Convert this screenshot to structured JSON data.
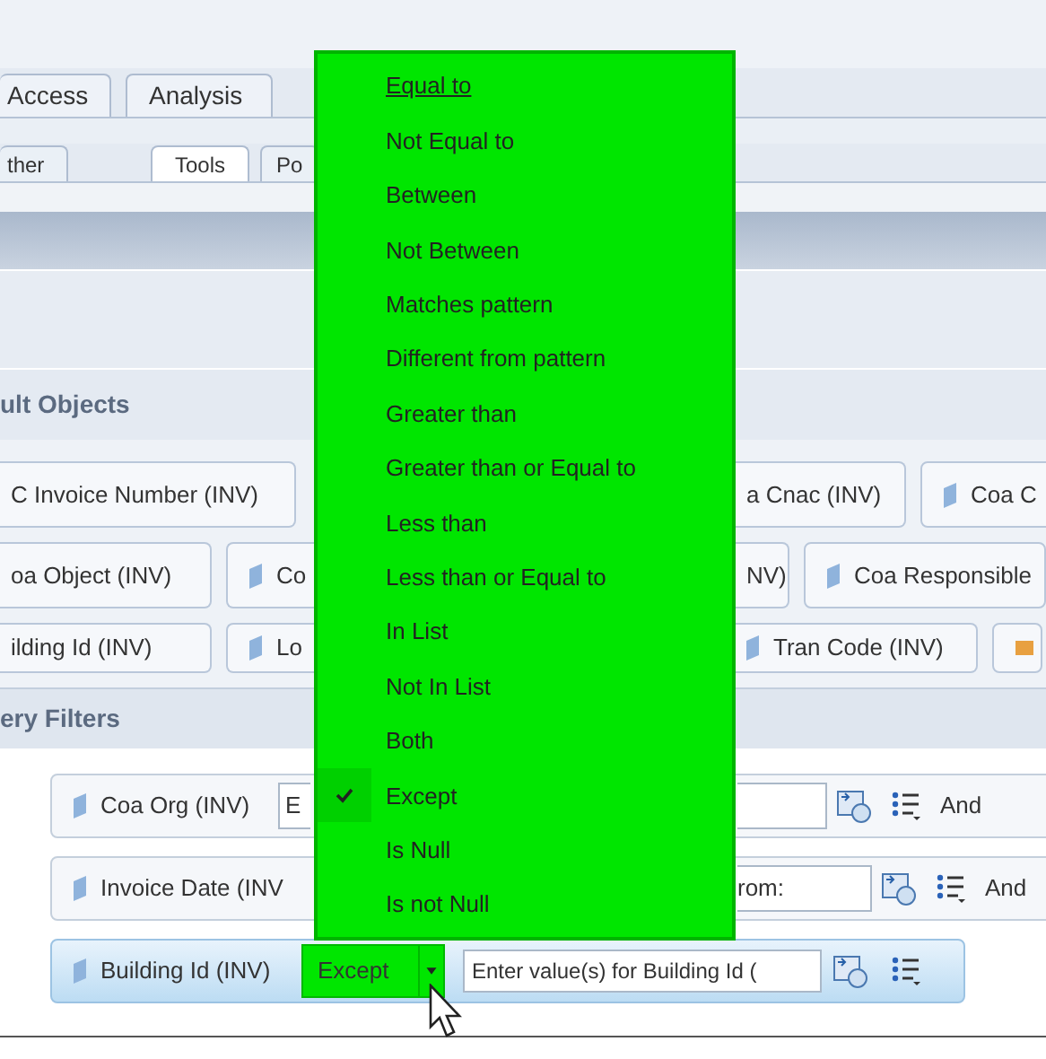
{
  "tabs": [
    {
      "label": "Access",
      "selected": false
    },
    {
      "label": "Analysis",
      "selected": false
    }
  ],
  "subtabs": [
    {
      "label": "ther",
      "selected": false
    },
    {
      "label": "Tools",
      "selected": true
    },
    {
      "label": "Po",
      "selected": false
    }
  ],
  "result_objects": {
    "title": "ult Objects",
    "rows": [
      {
        "left": [
          {
            "kind": "object",
            "label": "C Invoice Number (INV)",
            "icon": false
          }
        ],
        "right": [
          {
            "kind": "object",
            "label": "a Cnac (INV)",
            "icon": false
          },
          {
            "kind": "object",
            "label": "Coa C",
            "icon": true
          }
        ]
      },
      {
        "left": [
          {
            "kind": "object",
            "label": "oa Object (INV)",
            "icon": false
          },
          {
            "kind": "object",
            "label": "Co",
            "icon": true
          }
        ],
        "right": [
          {
            "kind": "object",
            "label": "NV)",
            "icon": false
          },
          {
            "kind": "object",
            "label": "Coa Responsible",
            "icon": true
          }
        ]
      },
      {
        "left": [
          {
            "kind": "object",
            "label": "ilding Id (INV)",
            "icon": false
          },
          {
            "kind": "object",
            "label": "Lo",
            "icon": true
          }
        ],
        "right": [
          {
            "kind": "object",
            "label": "Tran Code (INV)",
            "icon": true
          },
          {
            "kind": "measure"
          }
        ]
      }
    ]
  },
  "query_filters": {
    "title": "ery Filters",
    "filters": [
      {
        "object": "Coa Org (INV)",
        "operator": "E",
        "connector": "And",
        "selected": false
      },
      {
        "object": "Invoice Date (INV",
        "value": "rom:",
        "connector": "And",
        "selected": false
      },
      {
        "object": "Building Id (INV)",
        "operator": "Except",
        "placeholder": "Enter value(s) for Building Id (",
        "selected": true
      }
    ]
  },
  "operator_menu": {
    "items": [
      {
        "label": "Equal to",
        "checked": false
      },
      {
        "label": "Not Equal to",
        "checked": false
      },
      {
        "label": "Between",
        "checked": false
      },
      {
        "label": "Not Between",
        "checked": false
      },
      {
        "label": "Matches pattern",
        "checked": false
      },
      {
        "label": "Different from pattern",
        "checked": false
      },
      {
        "label": "Greater than",
        "checked": false
      },
      {
        "label": "Greater than or Equal to",
        "checked": false
      },
      {
        "label": "Less than",
        "checked": false
      },
      {
        "label": "Less than or Equal to",
        "checked": false
      },
      {
        "label": "In List",
        "checked": false
      },
      {
        "label": "Not In List",
        "checked": false
      },
      {
        "label": "Both",
        "checked": false
      },
      {
        "label": "Except",
        "checked": true
      },
      {
        "label": "Is Null",
        "checked": false
      },
      {
        "label": "Is not Null",
        "checked": false
      }
    ]
  }
}
